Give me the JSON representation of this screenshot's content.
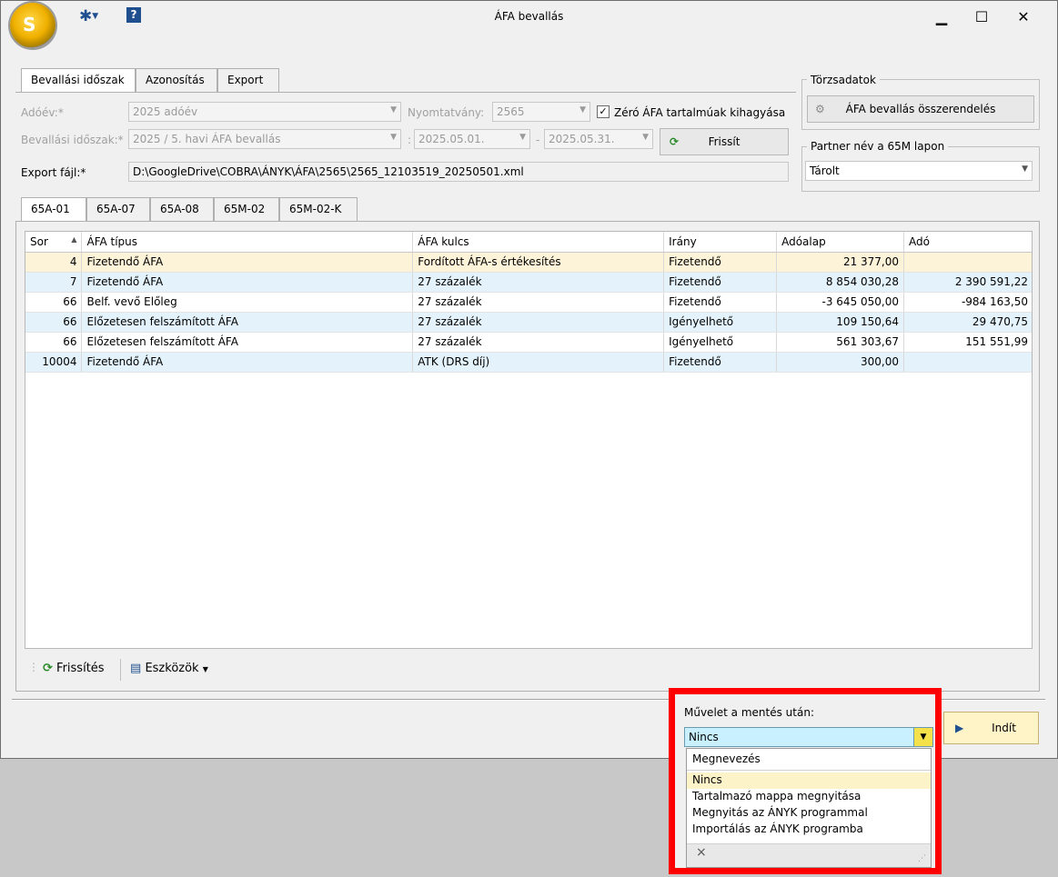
{
  "window": {
    "title": "ÁFA bevallás",
    "minimize": "▁",
    "maximize": "☐",
    "close": "✕"
  },
  "toolbar": {
    "settings_icon": "gear-icon",
    "help_icon": "help-icon"
  },
  "period_tabs": [
    {
      "label": "Bevallási időszak"
    },
    {
      "label": "Azonosítás"
    },
    {
      "label": "Export"
    }
  ],
  "form": {
    "year_label": "Adóév:*",
    "year_value": "2025 adóév",
    "form_label": "Nyomtatvány:",
    "form_value": "2565",
    "zero_checkbox_label": "Zéró ÁFA tartalmúak kihagyása",
    "period_label": "Bevallási időszak:*",
    "period_value": "2025 / 5. havi ÁFA bevallás",
    "date_sep1": ":",
    "date_from": "2025.05.01.",
    "date_sep2": "-",
    "date_to": "2025.05.31.",
    "refresh_button": "Frissít",
    "export_label": "Export fájl:*",
    "export_value": "D:\\GoogleDrive\\COBRA\\ÁNYK\\ÁFA\\2565\\2565_12103519_20250501.xml"
  },
  "master": {
    "group_title": "Törzsadatok",
    "assign_button": "ÁFA bevallás összerendelés"
  },
  "partner": {
    "group_title": "Partner név a 65M lapon",
    "value": "Tárolt"
  },
  "sheet_tabs": [
    {
      "label": "65A-01"
    },
    {
      "label": "65A-07"
    },
    {
      "label": "65A-08"
    },
    {
      "label": "65M-02"
    },
    {
      "label": "65M-02-K"
    }
  ],
  "grid": {
    "columns": [
      "Sor",
      "ÁFA típus",
      "ÁFA kulcs",
      "Irány",
      "Adóalap",
      "Adó"
    ],
    "rows": [
      [
        "4",
        "Fizetendő ÁFA",
        "Fordított ÁFA-s értékesítés",
        "Fizetendő",
        "21 377,00",
        ""
      ],
      [
        "7",
        "Fizetendő ÁFA",
        "27 százalék",
        "Fizetendő",
        "8 854 030,28",
        "2 390 591,22"
      ],
      [
        "66",
        "Belf. vevő Előleg",
        "27 százalék",
        "Fizetendő",
        "-3 645 050,00",
        "-984 163,50"
      ],
      [
        "66",
        "Előzetesen felszámított ÁFA",
        "27 százalék",
        "Igényelhető",
        "109 150,64",
        "29 470,75"
      ],
      [
        "66",
        "Előzetesen felszámított ÁFA",
        "27 százalék",
        "Igényelhető",
        "561 303,67",
        "151 551,99"
      ],
      [
        "10004",
        "Fizetendő ÁFA",
        "ATK (DRS díj)",
        "Fizetendő",
        "300,00",
        ""
      ]
    ]
  },
  "bottom_toolbar": {
    "refresh": "Frissítés",
    "tools": "Eszközök"
  },
  "after_save": {
    "label": "Művelet a mentés után:",
    "value": "Nincs",
    "list_header": "Megnevezés",
    "options": [
      "Nincs",
      "Tartalmazó mappa megnyitása",
      "Megnyitás az ÁNYK programmal",
      "Importálás az ÁNYK programba"
    ],
    "clear": "×"
  },
  "start_button": "Indít",
  "highlight_color": "#ff0000"
}
